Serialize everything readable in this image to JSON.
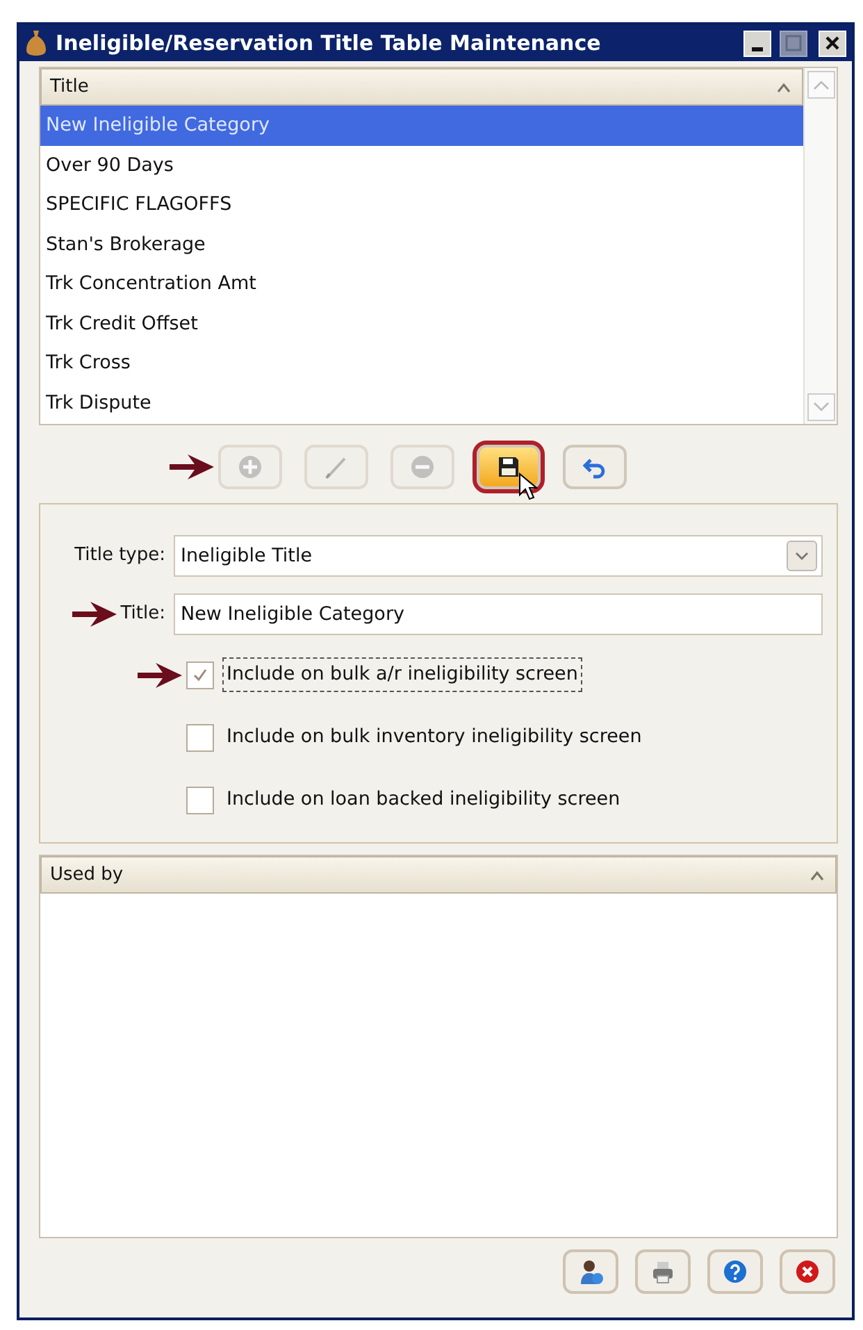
{
  "window": {
    "title": "Ineligible/Reservation Title Table Maintenance"
  },
  "title_list": {
    "column": "Title",
    "rows": [
      {
        "text": "New Ineligible Category",
        "selected": true
      },
      {
        "text": "Over 90 Days",
        "selected": false
      },
      {
        "text": "SPECIFIC FLAGOFFS",
        "selected": false
      },
      {
        "text": "Stan's Brokerage",
        "selected": false
      },
      {
        "text": "Trk Concentration Amt",
        "selected": false
      },
      {
        "text": "Trk Credit Offset",
        "selected": false
      },
      {
        "text": "Trk Cross",
        "selected": false
      },
      {
        "text": "Trk Dispute",
        "selected": false
      }
    ]
  },
  "toolbar": [
    {
      "kind": "add",
      "disabled": true,
      "highlighted": false,
      "marked": true
    },
    {
      "kind": "edit",
      "disabled": true,
      "highlighted": false,
      "marked": false
    },
    {
      "kind": "delete",
      "disabled": true,
      "highlighted": false,
      "marked": false
    },
    {
      "kind": "save",
      "disabled": false,
      "highlighted": true,
      "marked": false
    },
    {
      "kind": "undo",
      "disabled": false,
      "highlighted": false,
      "marked": false
    }
  ],
  "form": {
    "title_type": {
      "label": "Title type:",
      "value": "Ineligible Title",
      "marked": false
    },
    "title": {
      "label": "Title:",
      "value": "New Ineligible Category",
      "marked": true
    },
    "checkboxes": [
      {
        "label": "Include on bulk a/r ineligibility screen",
        "checked": true,
        "focused": true,
        "marked": true
      },
      {
        "label": "Include on bulk inventory ineligibility screen",
        "checked": false,
        "focused": false,
        "marked": false
      },
      {
        "label": "Include on loan backed ineligibility screen",
        "checked": false,
        "focused": false,
        "marked": false
      }
    ]
  },
  "used_by": {
    "column": "Used by"
  },
  "footer_buttons": [
    {
      "kind": "user"
    },
    {
      "kind": "print"
    },
    {
      "kind": "help"
    },
    {
      "kind": "close"
    }
  ]
}
